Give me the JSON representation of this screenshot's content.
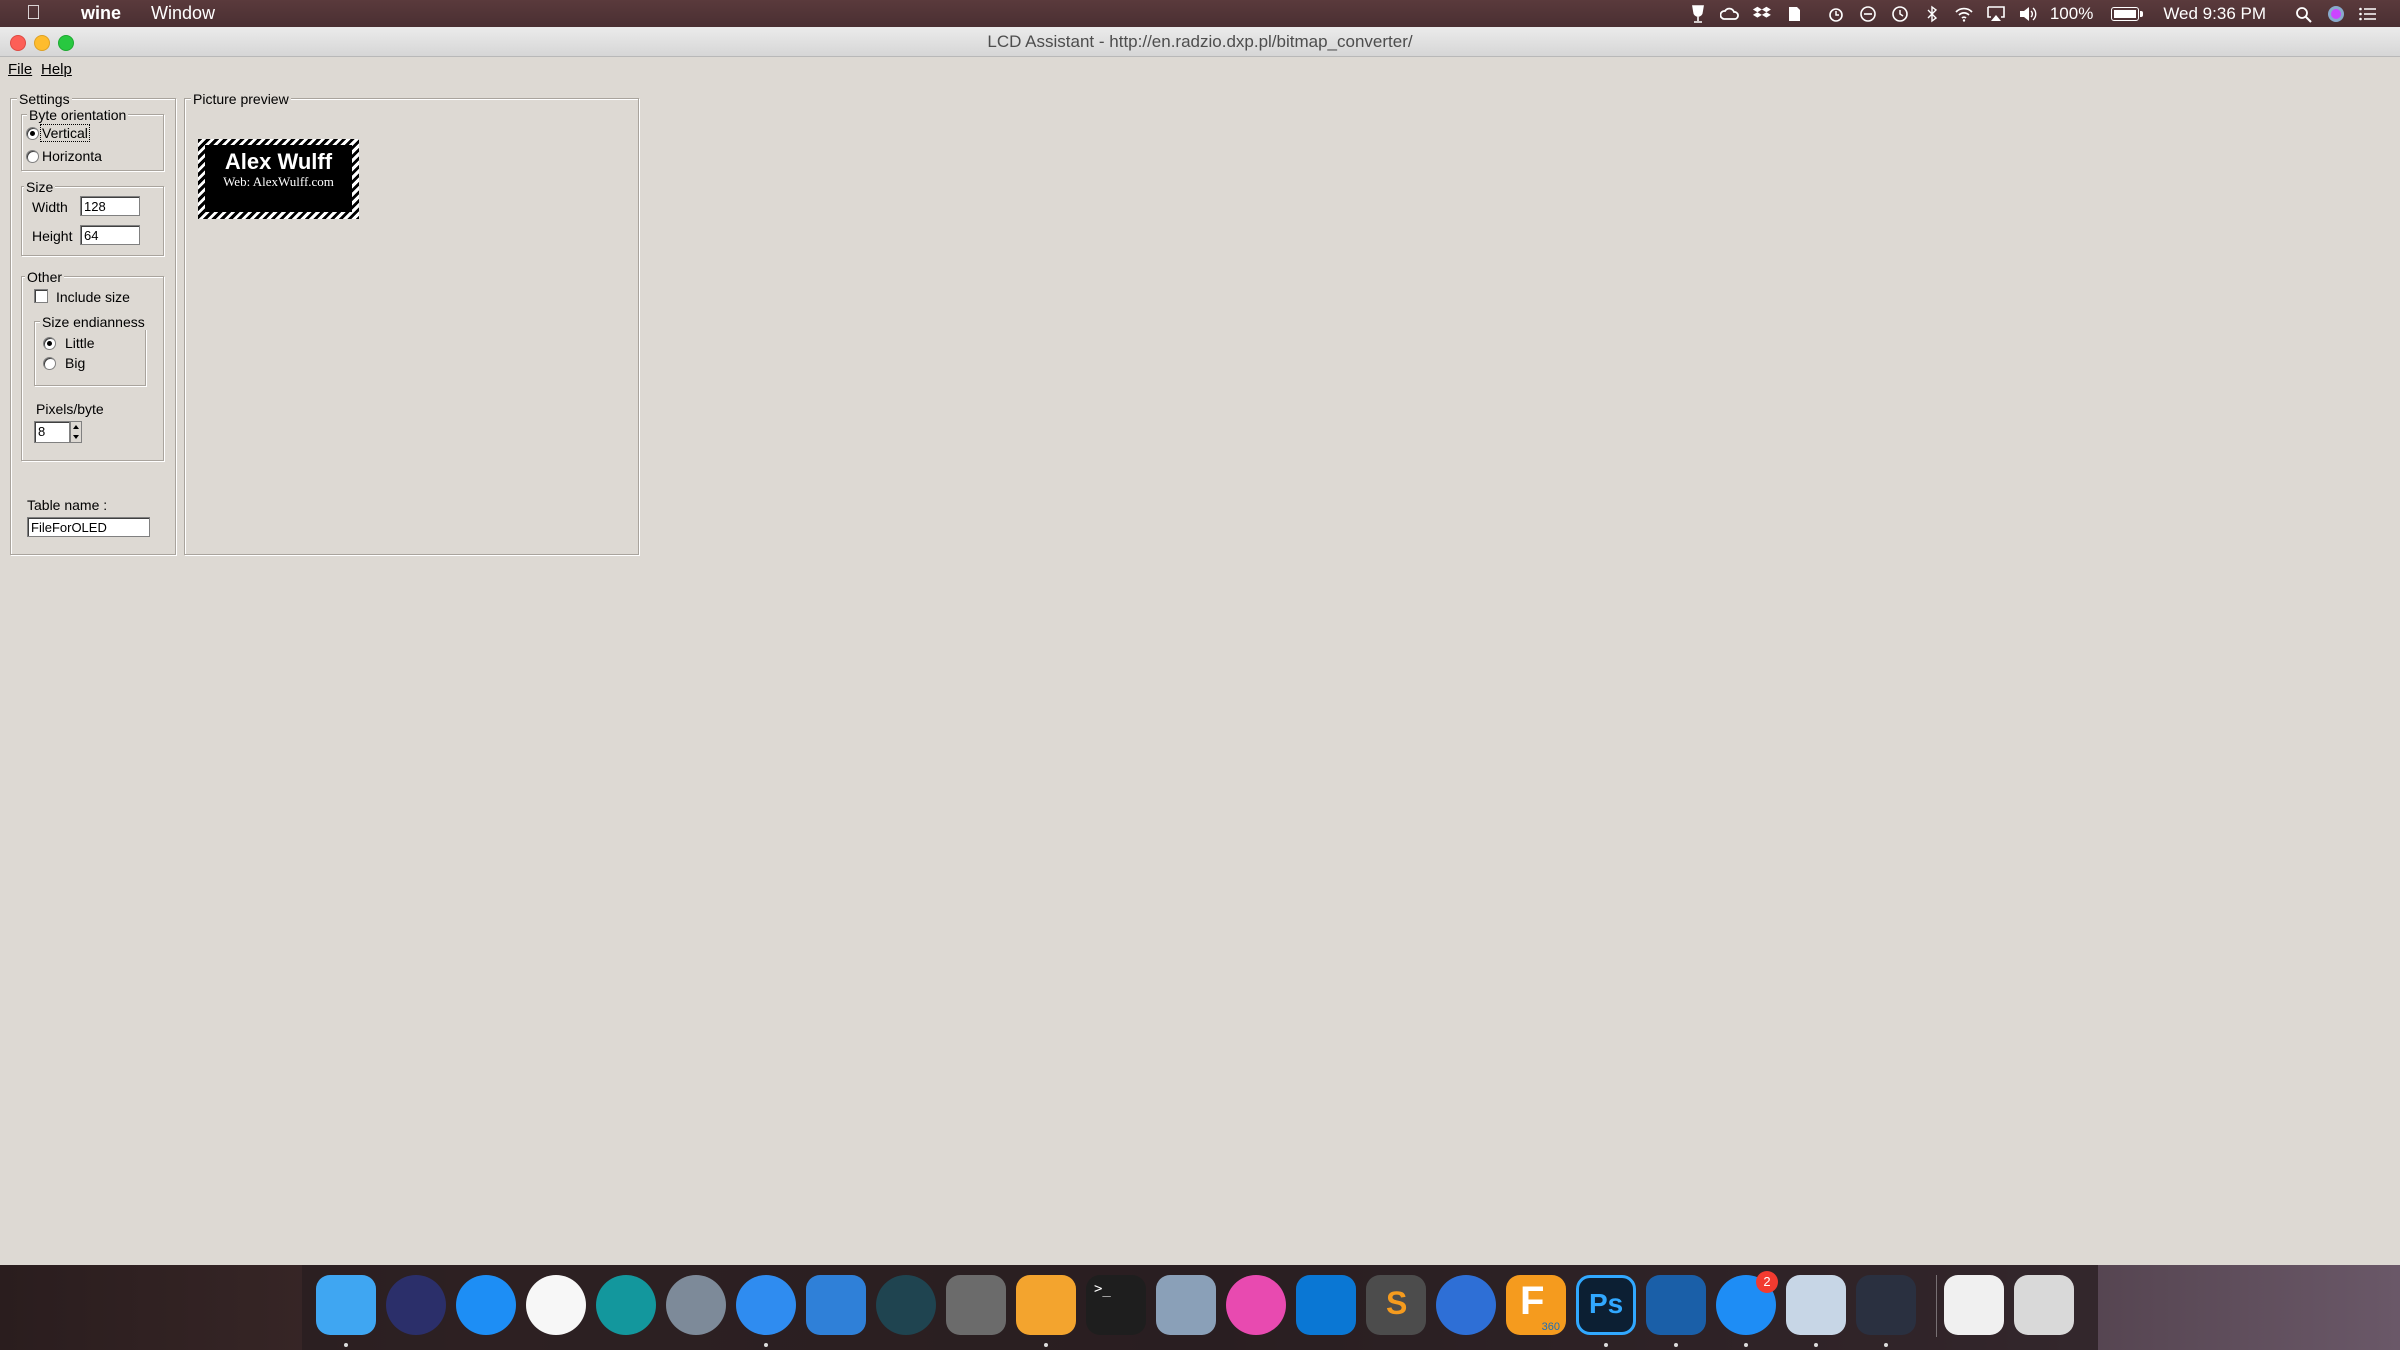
{
  "menubar": {
    "app_name": "wine",
    "menu_window": "Window",
    "battery": "100%",
    "battery_level": 1.0,
    "clock": "Wed 9:36 PM",
    "status_icons": [
      "wine-glass-icon",
      "creative-cloud-icon",
      "dropbox-icon",
      "evernote-icon",
      "alarm-icon",
      "sync-icon",
      "time-machine-icon",
      "bluetooth-icon",
      "wifi-icon",
      "airplay-icon",
      "volume-icon",
      "spotlight-icon",
      "siri-icon",
      "notification-center-icon"
    ]
  },
  "window": {
    "title": "LCD Assistant -  http://en.radzio.dxp.pl/bitmap_converter/",
    "menu": {
      "file": "File",
      "help": "Help"
    }
  },
  "settings": {
    "group_label": "Settings",
    "byte_orientation": {
      "label": "Byte orientation",
      "vertical": "Vertical",
      "horizontal": "Horizonta",
      "selected": "Vertical"
    },
    "size": {
      "label": "Size",
      "width_label": "Width",
      "width_value": "128",
      "height_label": "Height",
      "height_value": "64"
    },
    "other": {
      "label": "Other",
      "include_size": "Include size",
      "include_size_checked": false,
      "size_endianness": {
        "label": "Size endianness",
        "little": "Little",
        "big": "Big",
        "selected": "Little"
      },
      "pixels_per_byte_label": "Pixels/byte",
      "pixels_per_byte_value": "8"
    },
    "table_name_label": "Table name :",
    "table_name_value": "FileForOLED"
  },
  "preview": {
    "label": "Picture preview",
    "image_line1": "Alex Wulff",
    "image_line2": "Web: AlexWulff.com"
  },
  "dock": {
    "apps": [
      {
        "name": "finder",
        "color": "#3fa6f2"
      },
      {
        "name": "siri",
        "color": "#2b2f6a"
      },
      {
        "name": "app-store",
        "color": "#1d8ef5"
      },
      {
        "name": "itunes",
        "color": "#f7f7f7"
      },
      {
        "name": "arduino",
        "color": "#13979d"
      },
      {
        "name": "launchpad",
        "color": "#7d8a99"
      },
      {
        "name": "safari",
        "color": "#2f8cf0"
      },
      {
        "name": "xcode",
        "color": "#2f80d8"
      },
      {
        "name": "time-machine",
        "color": "#1f4450"
      },
      {
        "name": "system-preferences",
        "color": "#6b6b6b"
      },
      {
        "name": "pages",
        "color": "#f3a42e"
      },
      {
        "name": "terminal",
        "color": "#1e1e1e"
      },
      {
        "name": "preview-app",
        "color": "#8aa0b8"
      },
      {
        "name": "color-picker",
        "color": "#e84ab0"
      },
      {
        "name": "cura",
        "color": "#0a77d4"
      },
      {
        "name": "sublime-text",
        "color": "#4c4c4c"
      },
      {
        "name": "simplenote",
        "color": "#2e6fd6"
      },
      {
        "name": "fusion-360",
        "color": "#f59b1e"
      },
      {
        "name": "photoshop",
        "color": "#0c1f33"
      },
      {
        "name": "sigma",
        "color": "#1a5fa8"
      },
      {
        "name": "messenger",
        "color": "#1e8df5"
      },
      {
        "name": "preview-photos",
        "color": "#c7d6e6"
      },
      {
        "name": "camera-eye",
        "color": "#2a3040"
      },
      {
        "name": "lcd-assistant-window",
        "color": "#f0f0f0"
      },
      {
        "name": "trash",
        "color": "#d9d9d9"
      }
    ],
    "badge": "2",
    "fusion_label": "360",
    "photoshop_label": "Ps",
    "sublime_label": "S",
    "fusion_letter": "F"
  }
}
